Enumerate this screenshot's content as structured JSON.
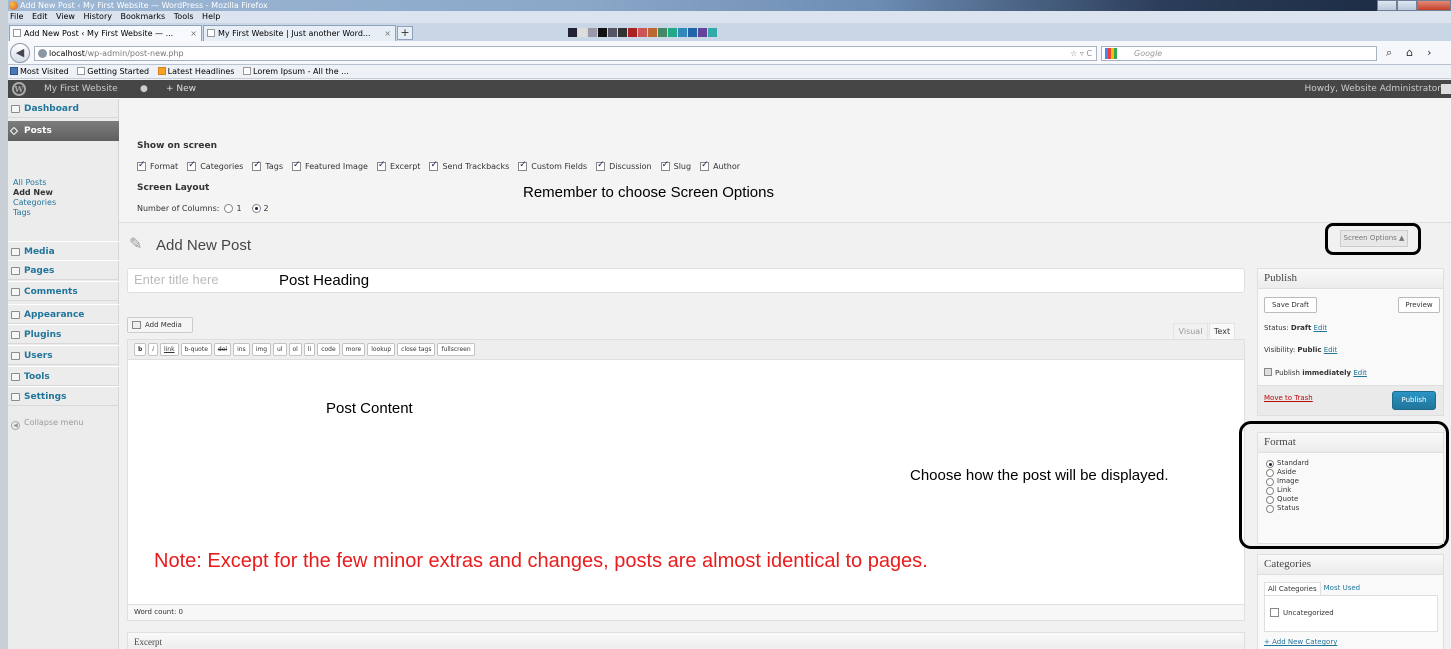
{
  "browser": {
    "window_title": "Add New Post ‹ My First Website — WordPress - Mozilla Firefox",
    "menu": [
      "File",
      "Edit",
      "View",
      "History",
      "Bookmarks",
      "Tools",
      "Help"
    ],
    "tabs": [
      {
        "label": "Add New Post ‹ My First Website — ...",
        "active": true
      },
      {
        "label": "My First Website | Just another Word...",
        "active": false
      }
    ],
    "new_tab": "+",
    "url_host": "localhost",
    "url_path": "/wp-admin/post-new.php",
    "search_placeholder": "Google",
    "bookmarks": [
      "Most Visited",
      "Getting Started",
      "Latest Headlines",
      "Lorem Ipsum - All the ..."
    ]
  },
  "adminbar": {
    "site_name": "My First Website",
    "new_label": "New",
    "howdy": "Howdy, Website Administrator"
  },
  "sidebar": {
    "items": [
      {
        "label": "Dashboard"
      },
      {
        "label": "Posts"
      },
      {
        "label": "Media"
      },
      {
        "label": "Pages"
      },
      {
        "label": "Comments"
      },
      {
        "label": "Appearance"
      },
      {
        "label": "Plugins"
      },
      {
        "label": "Users"
      },
      {
        "label": "Tools"
      },
      {
        "label": "Settings"
      }
    ],
    "submenu": [
      "All Posts",
      "Add New",
      "Categories",
      "Tags"
    ],
    "collapse": "Collapse menu"
  },
  "screen_options": {
    "show_on_screen": "Show on screen",
    "checkboxes": [
      "Format",
      "Categories",
      "Tags",
      "Featured Image",
      "Excerpt",
      "Send Trackbacks",
      "Custom Fields",
      "Discussion",
      "Slug",
      "Author"
    ],
    "layout_title": "Screen Layout",
    "columns_label": "Number of Columns:",
    "col_1": "1",
    "col_2": "2",
    "toggle_label": "Screen Options ▲"
  },
  "annotations": {
    "screen_options_note": "Remember to choose Screen Options",
    "post_heading": "Post Heading",
    "post_content": "Post Content",
    "display_note": "Choose how the post will be displayed.",
    "red_note": "Note: Except for the few minor extras and changes, posts are almost identical to pages."
  },
  "main": {
    "page_title": "Add New Post",
    "title_placeholder": "Enter title here",
    "add_media": "Add Media",
    "visual_tab": "Visual",
    "text_tab": "Text",
    "quicktags": [
      "b",
      "i",
      "link",
      "b-quote",
      "del",
      "ins",
      "img",
      "ul",
      "ol",
      "li",
      "code",
      "more",
      "lookup",
      "close tags",
      "fullscreen"
    ],
    "word_count": "Word count: 0",
    "excerpt_title": "Excerpt"
  },
  "publish": {
    "title": "Publish",
    "save_draft": "Save Draft",
    "preview": "Preview",
    "status_label": "Status:",
    "status_value": "Draft",
    "visibility_label": "Visibility:",
    "visibility_value": "Public",
    "publish_label": "Publish",
    "publish_value": "immediately",
    "edit": "Edit",
    "trash": "Move to Trash",
    "publish_button": "Publish"
  },
  "format": {
    "title": "Format",
    "options": [
      "Standard",
      "Aside",
      "Image",
      "Link",
      "Quote",
      "Status"
    ],
    "selected": "Standard"
  },
  "categories": {
    "title": "Categories",
    "tab_all": "All Categories",
    "tab_used": "Most Used",
    "items": [
      "Uncategorized"
    ],
    "add_new": "+ Add New Category"
  },
  "colors": {
    "admin_bar": "#464646",
    "link": "#21759b",
    "publish_button": "#21759b",
    "note_red": "#e81c1c"
  }
}
